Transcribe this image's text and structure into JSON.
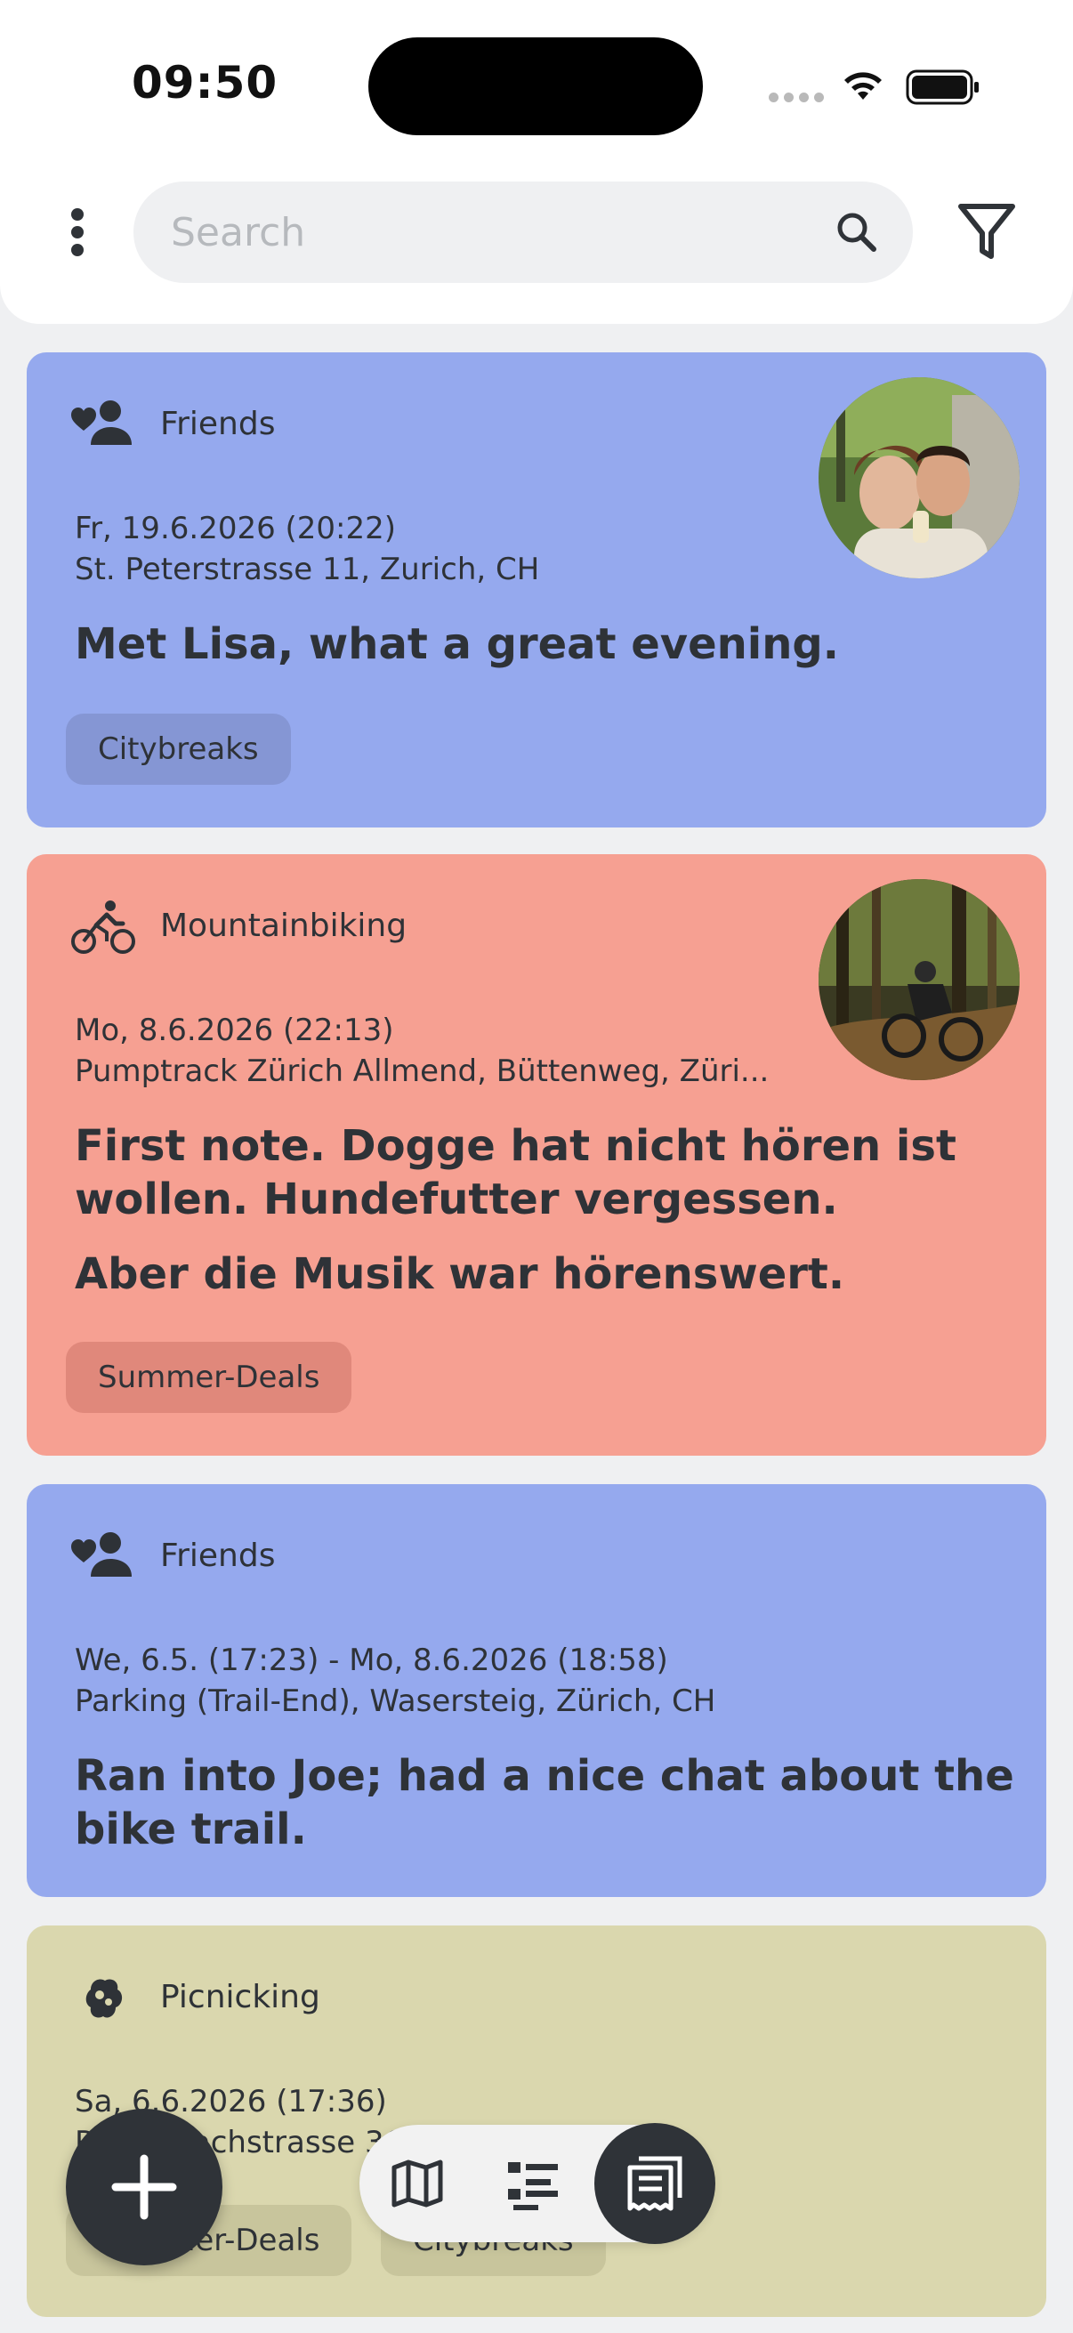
{
  "status_bar": {
    "time": "09:50"
  },
  "search": {
    "placeholder": "Search",
    "value": ""
  },
  "cards": [
    {
      "category": "Friends",
      "category_icon": "friends-heart-icon",
      "color": "#95a9ee",
      "date": "Fr, 19.6.2026 (20:22)",
      "location": "St. Peterstrasse 11, Zurich, CH",
      "title": "Met Lisa, what a great evening.",
      "tags": [
        "Citybreaks"
      ],
      "has_photo": true
    },
    {
      "category": "Mountainbiking",
      "category_icon": "bike-icon",
      "color": "#f6a092",
      "date": "Mo, 8.6.2026 (22:13)",
      "location": "Pumptrack Zürich Allmend, Büttenweg, Züri...",
      "title": "First note. Dogge hat nicht hören ist wollen. Hundefutter vergessen.",
      "title2": "Aber die Musik war hörenswert.",
      "tags": [
        "Summer-Deals"
      ],
      "has_photo": true
    },
    {
      "category": "Friends",
      "category_icon": "friends-heart-icon",
      "color": "#95a9ee",
      "date": "We, 6.5. (17:23) - Mo, 8.6.2026 (18:58)",
      "location": "Parking (Trail-End), Wasersteig, Zürich, CH",
      "title": "Ran into Joe; had a nice chat about the bike trail.",
      "tags": [],
      "has_photo": false
    },
    {
      "category": "Picnicking",
      "category_icon": "picnic-icon",
      "color": "#dad7ae",
      "date": "Sa, 6.6.2026 (17:36)",
      "location": "Röschibachstrasse 36, Zürich, CH",
      "title": "",
      "tags": [
        "Summer-Deals",
        "Citybreaks"
      ],
      "has_photo": false
    }
  ],
  "bottom_nav": {
    "items": [
      "map-view",
      "list-view",
      "notes-view"
    ],
    "active": "notes-view"
  }
}
